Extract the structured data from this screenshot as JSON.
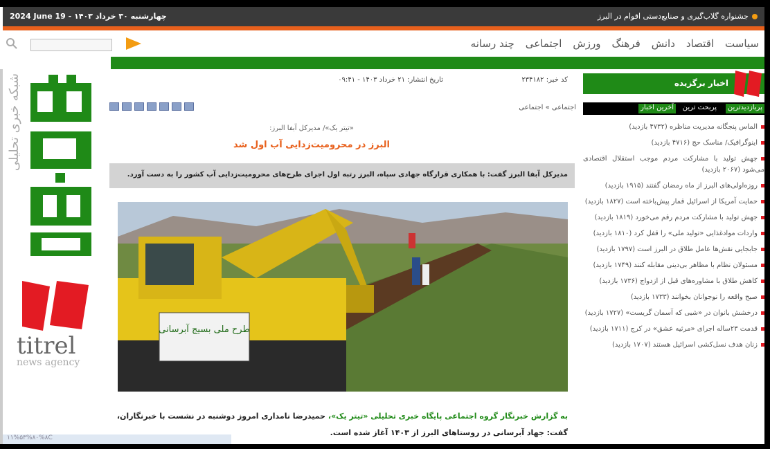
{
  "topbar": {
    "date": "2024 June 19 - ۱۴۰۳ چهارشنبه ۳۰ خرداد",
    "headline": "جشنواره گلاب‌گیری و صنایع‌دستی اقوام در البرز"
  },
  "search": {
    "placeholder": ""
  },
  "menu": [
    "سیاست",
    "اقتصاد",
    "دانش",
    "فرهنگ",
    "ورزش",
    "اجتماعی",
    "چند رسانه"
  ],
  "logo": {
    "vertical_text": "شبکه خبری تحلیلی",
    "brand": "titrel",
    "agency": "news agency"
  },
  "article": {
    "code": "کد خبر: ۲۳۴۱۸۲",
    "date": "تاریخ انتشار: ۲۱ خرداد ۱۴۰۳ - ۰۹:۴۱",
    "breadcrumb": "اجتماعی » اجتماعی",
    "supertitle": "«تیتر یک»/ مدیرکل آبفا البرز:",
    "headline": "البرز در محرومیت‌زدایی آب اول شد",
    "lead": "مدیرکل آبفا البرز گفت: با همکاری قرارگاه جهادی سپاه، البرز رتبه اول اجرای طرح‌های محرومیت‌زدایی آب کشور را به دست آورد.",
    "photo_sign": "طرح ملی بسیج آبرسانی",
    "body_source": "به گزارش خبرنگار گروه اجتماعی پایگاه خبری تحلیلی «تیتر یک»،",
    "body_rest": " حمیدرضا نامداری امروز دوشنبه در نشست با خبرنگاران، گفت: جهاد آبرسانی در روستاهای البرز از ۱۴۰۳ آغاز شده است."
  },
  "status_url": "۱۱%۵۳%۸۰%۸C",
  "sidebar": {
    "title": "اخبار برگزیده",
    "tabs": [
      "پربازدیدترین",
      "پربحث ترین",
      "آخرین اخبار"
    ],
    "items": [
      "الماس پنجگانه مدیریت مناظره (۴۷۳۲ بازدید)",
      "اینوگرافیک/ مناسک حج (۴۷۱۶ بازدید)",
      "جهش تولید با مشارکت مردم موجب استقلال اقتصادی می‌شود (۲۰۶۷ بازدید)",
      "روزه‌اولی‌های البرز از ماه رمضان گفتند (۱۹۱۵ بازدید)",
      "حمایت آمریکا از اسرائیل قمار پیش‌باخته است (۱۸۲۷ بازدید)",
      "جهش تولید با مشارکت مردم رقم می‌خورد (۱۸۱۹ بازدید)",
      "واردات موادغذایی «تولید ملی» را قفل کرد (۱۸۱۰ بازدید)",
      "جابجایی نقش‌ها عامل طلاق در البرز است (۱۷۹۷ بازدید)",
      "مسئولان نظام با مظاهر بی‌دینی مقابله کنند (۱۷۴۹ بازدید)",
      "کاهش طلاق با مشاوره‌های قبل از ازدواج (۱۷۳۶ بازدید)",
      "صبح واقعه را نوجوانان بخوانند (۱۷۳۳ بازدید)",
      "درخشش بانوان در «شبی که آسمان گریست» (۱۷۲۷ بازدید)",
      "قدمت ۲۳ساله اجرای «مرثیه عشق» در کرج (۱۷۱۱ بازدید)",
      "زنان هدف نسل‌کشی اسرائیل هستند (۱۷۰۷ بازدید)"
    ]
  },
  "colors": {
    "accent": "#e8601c",
    "brand_green": "#1f8a17",
    "brand_red": "#e31b23"
  }
}
